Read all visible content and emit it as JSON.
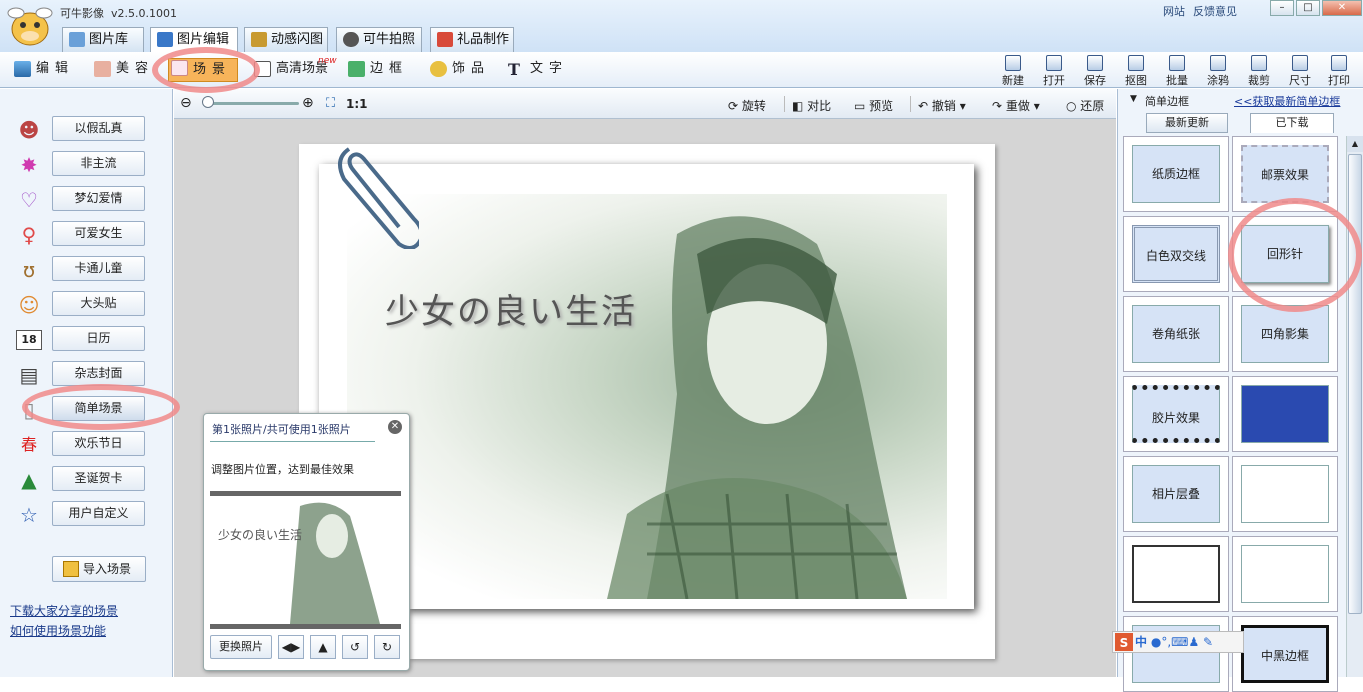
{
  "app": {
    "title": "可牛影像",
    "version": "v2.5.0.1001",
    "links": [
      "网站",
      "反馈意见"
    ]
  },
  "tabs": [
    {
      "label": "图片库"
    },
    {
      "label": "图片编辑"
    },
    {
      "label": "动感闪图"
    },
    {
      "label": "可牛拍照"
    },
    {
      "label": "礼品制作"
    }
  ],
  "toolbar": {
    "items": [
      {
        "label": "编辑"
      },
      {
        "label": "美容"
      },
      {
        "label": "场景"
      },
      {
        "label": "高清场景"
      },
      {
        "label": "边框"
      },
      {
        "label": "饰品"
      },
      {
        "label": "文字"
      }
    ],
    "badge": "new",
    "right": [
      {
        "label": "新建"
      },
      {
        "label": "打开"
      },
      {
        "label": "保存"
      },
      {
        "label": "抠图"
      },
      {
        "label": "批量"
      },
      {
        "label": "涂鸦"
      },
      {
        "label": "裁剪"
      },
      {
        "label": "尺寸"
      },
      {
        "label": "打印"
      }
    ]
  },
  "sidebar": {
    "items": [
      {
        "label": "以假乱真",
        "icon": "mask-icon"
      },
      {
        "label": "非主流",
        "icon": "star-burst-icon"
      },
      {
        "label": "梦幻爱情",
        "icon": "heart-icon"
      },
      {
        "label": "可爱女生",
        "icon": "female-icon"
      },
      {
        "label": "卡通儿童",
        "icon": "cartoon-icon"
      },
      {
        "label": "大头贴",
        "icon": "avatar-icon"
      },
      {
        "label": "日历",
        "icon": "calendar-icon"
      },
      {
        "label": "杂志封面",
        "icon": "magazine-icon"
      },
      {
        "label": "简单场景",
        "icon": "scene-icon"
      },
      {
        "label": "欢乐节日",
        "icon": "spring-icon"
      },
      {
        "label": "圣诞贺卡",
        "icon": "tree-icon"
      },
      {
        "label": "用户自定义",
        "icon": "star-outline-icon"
      }
    ],
    "import": "导入场景",
    "links": [
      "下载大家分享的场景",
      "如何使用场景功能"
    ]
  },
  "canvas": {
    "zoom": "1:1",
    "tools": [
      "旋转",
      "对比",
      "预览",
      "撤销",
      "重做",
      "还原"
    ],
    "photo_text": "少女の良い生活"
  },
  "popup": {
    "title": "第1张照片/共可使用1张照片",
    "hint": "调整图片位置，达到最佳效果",
    "thumb_text": "少女の良い生活",
    "change": "更换照片"
  },
  "rpanel": {
    "title": "简单边框",
    "link": "<<获取最新简单边框",
    "tabs": [
      "最新更新",
      "已下载"
    ],
    "thumbs": [
      {
        "label": "纸质边框"
      },
      {
        "label": "邮票效果"
      },
      {
        "label": "白色双交线"
      },
      {
        "label": "回形针"
      },
      {
        "label": "卷角纸张"
      },
      {
        "label": "四角影集"
      },
      {
        "label": "胶片效果"
      },
      {
        "label": ""
      },
      {
        "label": "相片层叠"
      },
      {
        "label": ""
      },
      {
        "label": ""
      },
      {
        "label": ""
      },
      {
        "label": ""
      },
      {
        "label": "中黑边框"
      }
    ]
  },
  "ime": "中"
}
